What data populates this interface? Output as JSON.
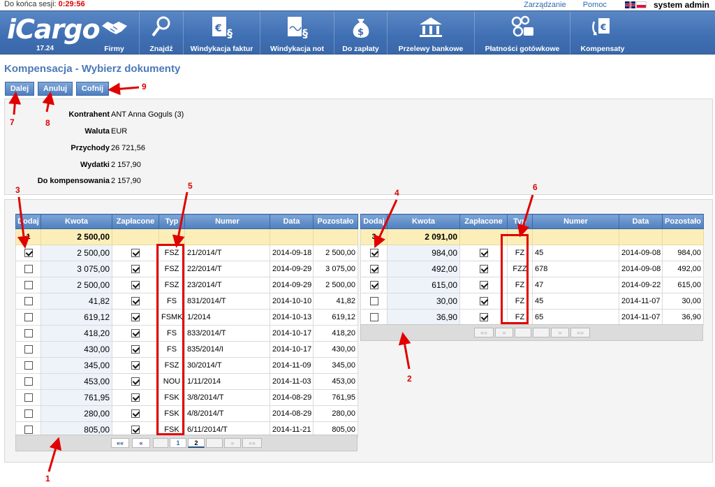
{
  "session": {
    "label": "Do końca sesji:",
    "timer": "0:29:56"
  },
  "top_links": {
    "manage": "Zarządzanie",
    "help": "Pomoc",
    "user": "system admin"
  },
  "nav": {
    "logo": "iCargo",
    "version": "17.24",
    "items": [
      {
        "label": "Firmy",
        "icon": "handshake-icon"
      },
      {
        "label": "Znajdź",
        "icon": "magnifier-icon"
      },
      {
        "label": "Windykacja faktur",
        "icon": "invoice-euro-icon"
      },
      {
        "label": "Windykacja not",
        "icon": "note-signature-icon"
      },
      {
        "label": "Do zapłaty",
        "icon": "money-bag-icon"
      },
      {
        "label": "Przelewy bankowe",
        "icon": "bank-icon"
      },
      {
        "label": "Płatności gotówkowe",
        "icon": "coins-icon"
      },
      {
        "label": "Kompensaty",
        "icon": "compensation-icon"
      }
    ]
  },
  "page": {
    "title": "Kompensacja - Wybierz dokumenty"
  },
  "buttons": {
    "next": "Dalej",
    "cancel": "Anuluj",
    "back": "Cofnij"
  },
  "info": {
    "contractor_label": "Kontrahent",
    "contractor": "ANT Anna Goguls (3)",
    "currency_label": "Waluta",
    "currency": "EUR",
    "income_label": "Przychody",
    "income": "26 721,56",
    "expenses_label": "Wydatki",
    "expenses": "2 157,90",
    "to_comp_label": "Do kompensowania",
    "to_comp": "2 157,90"
  },
  "columns": [
    "Dodaj",
    "Kwota",
    "Zapłacone",
    "Typ",
    "Numer",
    "Data",
    "Pozostało"
  ],
  "left_grid": {
    "sum": {
      "count": "1",
      "amount": "2 500,00"
    },
    "rows": [
      {
        "add": true,
        "amount": "2 500,00",
        "paid": true,
        "type": "FSZ",
        "number": "21/2014/T",
        "date": "2014-09-18",
        "remaining": "2 500,00"
      },
      {
        "add": false,
        "amount": "3 075,00",
        "paid": true,
        "type": "FSZ",
        "number": "22/2014/T",
        "date": "2014-09-29",
        "remaining": "3 075,00"
      },
      {
        "add": false,
        "amount": "2 500,00",
        "paid": true,
        "type": "FSZ",
        "number": "23/2014/T",
        "date": "2014-09-29",
        "remaining": "2 500,00"
      },
      {
        "add": false,
        "amount": "41,82",
        "paid": true,
        "type": "FS",
        "number": "831/2014/T",
        "date": "2014-10-10",
        "remaining": "41,82"
      },
      {
        "add": false,
        "amount": "619,12",
        "paid": true,
        "type": "FSMK",
        "number": "1/2014",
        "date": "2014-10-13",
        "remaining": "619,12"
      },
      {
        "add": false,
        "amount": "418,20",
        "paid": true,
        "type": "FS",
        "number": "833/2014/T",
        "date": "2014-10-17",
        "remaining": "418,20"
      },
      {
        "add": false,
        "amount": "430,00",
        "paid": true,
        "type": "FS",
        "number": "835/2014/I",
        "date": "2014-10-17",
        "remaining": "430,00"
      },
      {
        "add": false,
        "amount": "345,00",
        "paid": true,
        "type": "FSZ",
        "number": "30/2014/T",
        "date": "2014-11-09",
        "remaining": "345,00"
      },
      {
        "add": false,
        "amount": "453,00",
        "paid": true,
        "type": "NOU",
        "number": "1/11/2014",
        "date": "2014-11-03",
        "remaining": "453,00"
      },
      {
        "add": false,
        "amount": "761,95",
        "paid": true,
        "type": "FSK",
        "number": "3/8/2014/T",
        "date": "2014-08-29",
        "remaining": "761,95"
      },
      {
        "add": false,
        "amount": "280,00",
        "paid": true,
        "type": "FSK",
        "number": "4/8/2014/T",
        "date": "2014-08-29",
        "remaining": "280,00"
      },
      {
        "add": false,
        "amount": "805,00",
        "paid": true,
        "type": "FSK",
        "number": "6/11/2014/T",
        "date": "2014-11-21",
        "remaining": "805,00"
      }
    ],
    "pager": {
      "first": "««",
      "prev": "«",
      "page1": "1",
      "page2": "2",
      "next": "»",
      "last": "»»"
    }
  },
  "right_grid": {
    "sum": {
      "count": "3",
      "amount": "2 091,00"
    },
    "rows": [
      {
        "add": true,
        "amount": "984,00",
        "paid": true,
        "type": "FZ",
        "number": "45",
        "date": "2014-09-08",
        "remaining": "984,00"
      },
      {
        "add": true,
        "amount": "492,00",
        "paid": true,
        "type": "FZZ",
        "number": "678",
        "date": "2014-09-08",
        "remaining": "492,00"
      },
      {
        "add": true,
        "amount": "615,00",
        "paid": true,
        "type": "FZ",
        "number": "47",
        "date": "2014-09-22",
        "remaining": "615,00"
      },
      {
        "add": false,
        "amount": "30,00",
        "paid": true,
        "type": "FZ",
        "number": "45",
        "date": "2014-11-07",
        "remaining": "30,00"
      },
      {
        "add": false,
        "amount": "36,90",
        "paid": true,
        "type": "FZ",
        "number": "65",
        "date": "2014-11-07",
        "remaining": "36,90"
      }
    ],
    "pager": {
      "first": "««",
      "prev": "«",
      "next": "»",
      "last": "»»"
    }
  },
  "annotations": [
    "1",
    "2",
    "3",
    "4",
    "5",
    "6",
    "7",
    "8",
    "9"
  ],
  "colors": {
    "nav_blue": "#3f6fb3",
    "title_blue": "#4a7ab8",
    "sum_row": "#fbeeb8",
    "annotation_red": "#e00000"
  }
}
